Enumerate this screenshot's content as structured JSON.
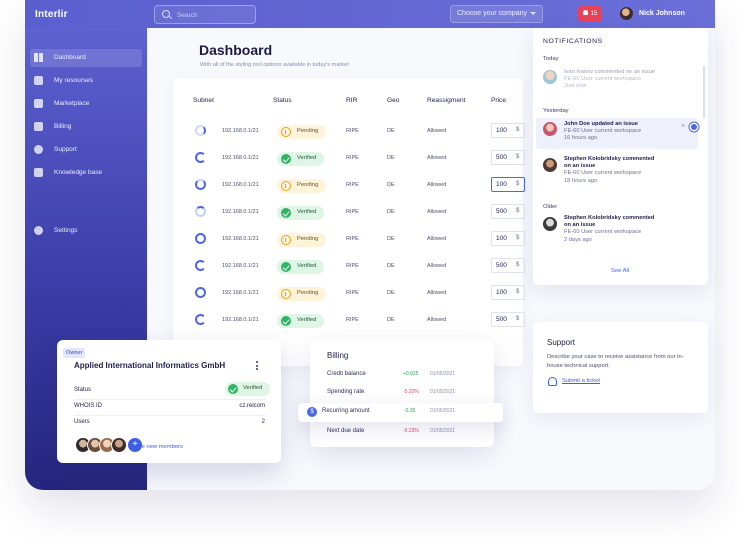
{
  "app": {
    "logo": "Interlir",
    "search_placeholder": "Search",
    "company_select": "Choose your company",
    "notif_count": "15",
    "user_name": "Nick Johnson"
  },
  "sidebar": {
    "items": [
      {
        "label": "Dashboard",
        "icon": "grid-icon",
        "active": true
      },
      {
        "label": "My resourses",
        "icon": "box-icon"
      },
      {
        "label": "Marketplace",
        "icon": "store-icon"
      },
      {
        "label": "Billing",
        "icon": "card-icon"
      },
      {
        "label": "Support",
        "icon": "help-icon"
      },
      {
        "label": "Knowledge base",
        "icon": "graduation-icon"
      }
    ],
    "settings_label": "Settings"
  },
  "page": {
    "title": "Dashboard",
    "subtitle": "With all of the styling tool options available in today's market"
  },
  "table": {
    "headers": [
      "Subnet",
      "Status",
      "RIR",
      "Geo",
      "Reassigment",
      "Price"
    ],
    "rows": [
      {
        "subnet": "192.168.0.1/21",
        "status": "Pending",
        "rir": "RIPE",
        "geo": "DE",
        "reassignment": "Allowed",
        "price": "100",
        "currency": "$"
      },
      {
        "subnet": "192.168.0.1/21",
        "status": "Verified",
        "rir": "RIPE",
        "geo": "DE",
        "reassignment": "Allowed",
        "price": "500",
        "currency": "$"
      },
      {
        "subnet": "192.168.0.1/21",
        "status": "Pending",
        "rir": "RIPE",
        "geo": "DE",
        "reassignment": "Allowed",
        "price": "100",
        "currency": "$"
      },
      {
        "subnet": "192.168.0.1/21",
        "status": "Verified",
        "rir": "RIPE",
        "geo": "DE",
        "reassignment": "Allowed",
        "price": "500",
        "currency": "$"
      },
      {
        "subnet": "192.168.0.1/21",
        "status": "Pending",
        "rir": "RIPE",
        "geo": "DE",
        "reassignment": "Allowed",
        "price": "100",
        "currency": "$"
      },
      {
        "subnet": "192.168.0.1/21",
        "status": "Verified",
        "rir": "RIPE",
        "geo": "DE",
        "reassignment": "Allowed",
        "price": "500",
        "currency": "$"
      },
      {
        "subnet": "192.168.0.1/21",
        "status": "Pending",
        "rir": "RIPE",
        "geo": "DE",
        "reassignment": "Allowed",
        "price": "100",
        "currency": "$"
      },
      {
        "subnet": "192.168.0.1/21",
        "status": "Verified",
        "rir": "RIPE",
        "geo": "DE",
        "reassignment": "Allowed",
        "price": "500",
        "currency": "$"
      }
    ]
  },
  "notifications": {
    "title": "NOTIFICATIONS",
    "groups": {
      "today": "Today",
      "yesterday": "Yesterday",
      "older": "Older"
    },
    "items": [
      {
        "line1": "Ivan Ivanov commented on an issue",
        "line2": "",
        "sub": "FE-60 User current workspace",
        "time": "Just now"
      },
      {
        "line1": "John Doe updated an issue",
        "line2": "",
        "sub": "FE-60 User current workspace",
        "time": "16 hours ago"
      },
      {
        "line1": "Stephen Kolobridsky commented",
        "line2": "on an issue",
        "sub": "FE-60 User current workspace",
        "time": "18 hours ago"
      },
      {
        "line1": "Stephen Kolobridsky commented",
        "line2": "on an issue",
        "sub": "FE-60 User current workspace",
        "time": "2 days ago"
      }
    ],
    "close": "×",
    "see_all": "See All"
  },
  "support": {
    "title": "Support",
    "description": "Describe your case to receive assistance from our in-house technical support.",
    "link": "Submit a ticket"
  },
  "owner": {
    "tag": "Owner",
    "name": "Applied International Informatics GmbH",
    "status_label": "Status",
    "status_value": "Verified",
    "whois_label": "WHOIS ID",
    "whois_value": "cz.relcom",
    "users_label": "Users",
    "users_value": "2",
    "add_symbol": "+",
    "invite": "Invite new members"
  },
  "billing": {
    "title": "Billing",
    "rows": [
      {
        "label": "Credit balance",
        "change": "+0.025",
        "date": "01/05/2021",
        "trend": "up"
      },
      {
        "label": "Spending rate",
        "change": "-5.22%",
        "date": "01/05/2021",
        "trend": "down"
      },
      {
        "label": "Recurring amount",
        "change": "-0.35",
        "date": "01/05/2021",
        "trend": "up",
        "symbol": "$"
      },
      {
        "label": "Next due date",
        "change": "-5.23%",
        "date": "01/05/2021",
        "trend": "down"
      }
    ]
  },
  "colors": {
    "accent": "#5a5fcf",
    "link": "#3f5ee0",
    "verified": "#2fb466",
    "pending": "#e3a21e",
    "alert": "#e8415a"
  }
}
